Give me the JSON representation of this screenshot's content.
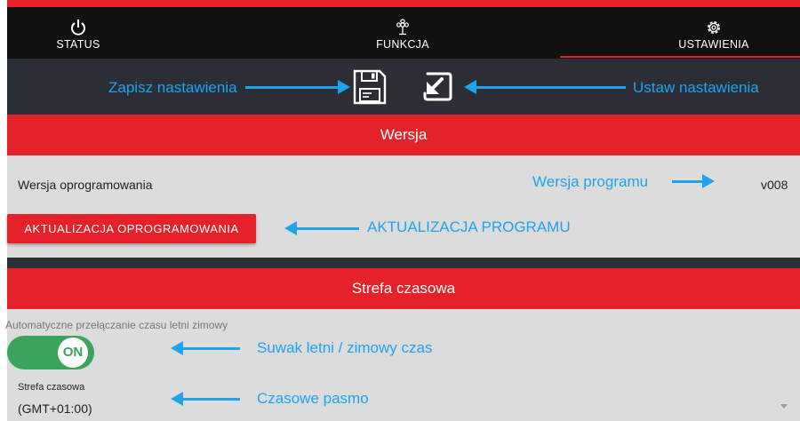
{
  "nav": {
    "tabs": [
      {
        "label": "STATUS",
        "icon": "power-icon"
      },
      {
        "label": "FUNKCJA",
        "icon": "fan-icon"
      },
      {
        "label": "USTAWIENIA",
        "icon": "gear-icon",
        "active": true
      }
    ]
  },
  "toolbar": {
    "save_annotation": "Zapisz nastawienia",
    "restore_annotation": "Ustaw nastawienia",
    "save_icon": "floppy-disk-icon",
    "restore_icon": "restore-arrow-icon"
  },
  "version_section": {
    "header": "Wersja",
    "firmware_label": "Wersja oprogramowania",
    "firmware_value": "v008",
    "firmware_annotation": "Wersja programu",
    "update_button": "AKTUALIZACJA OPROGRAMOWANIA",
    "update_annotation": "AKTUALIZACJA PROGRAMU"
  },
  "timezone_section": {
    "header": "Strefa czasowa",
    "dst_label": "Automatyczne przełączanie czasu letni zimowy",
    "dst_toggle": "ON",
    "dst_annotation": "Suwak  letni / zimowy czas",
    "tz_label": "Strefa czasowa",
    "tz_value": "(GMT+01:00)",
    "tz_annotation": "Czasowe pasmo"
  },
  "colors": {
    "accent_red": "#e52129",
    "annotation_blue": "#1ea3ef",
    "toggle_green": "#3aa35c"
  }
}
